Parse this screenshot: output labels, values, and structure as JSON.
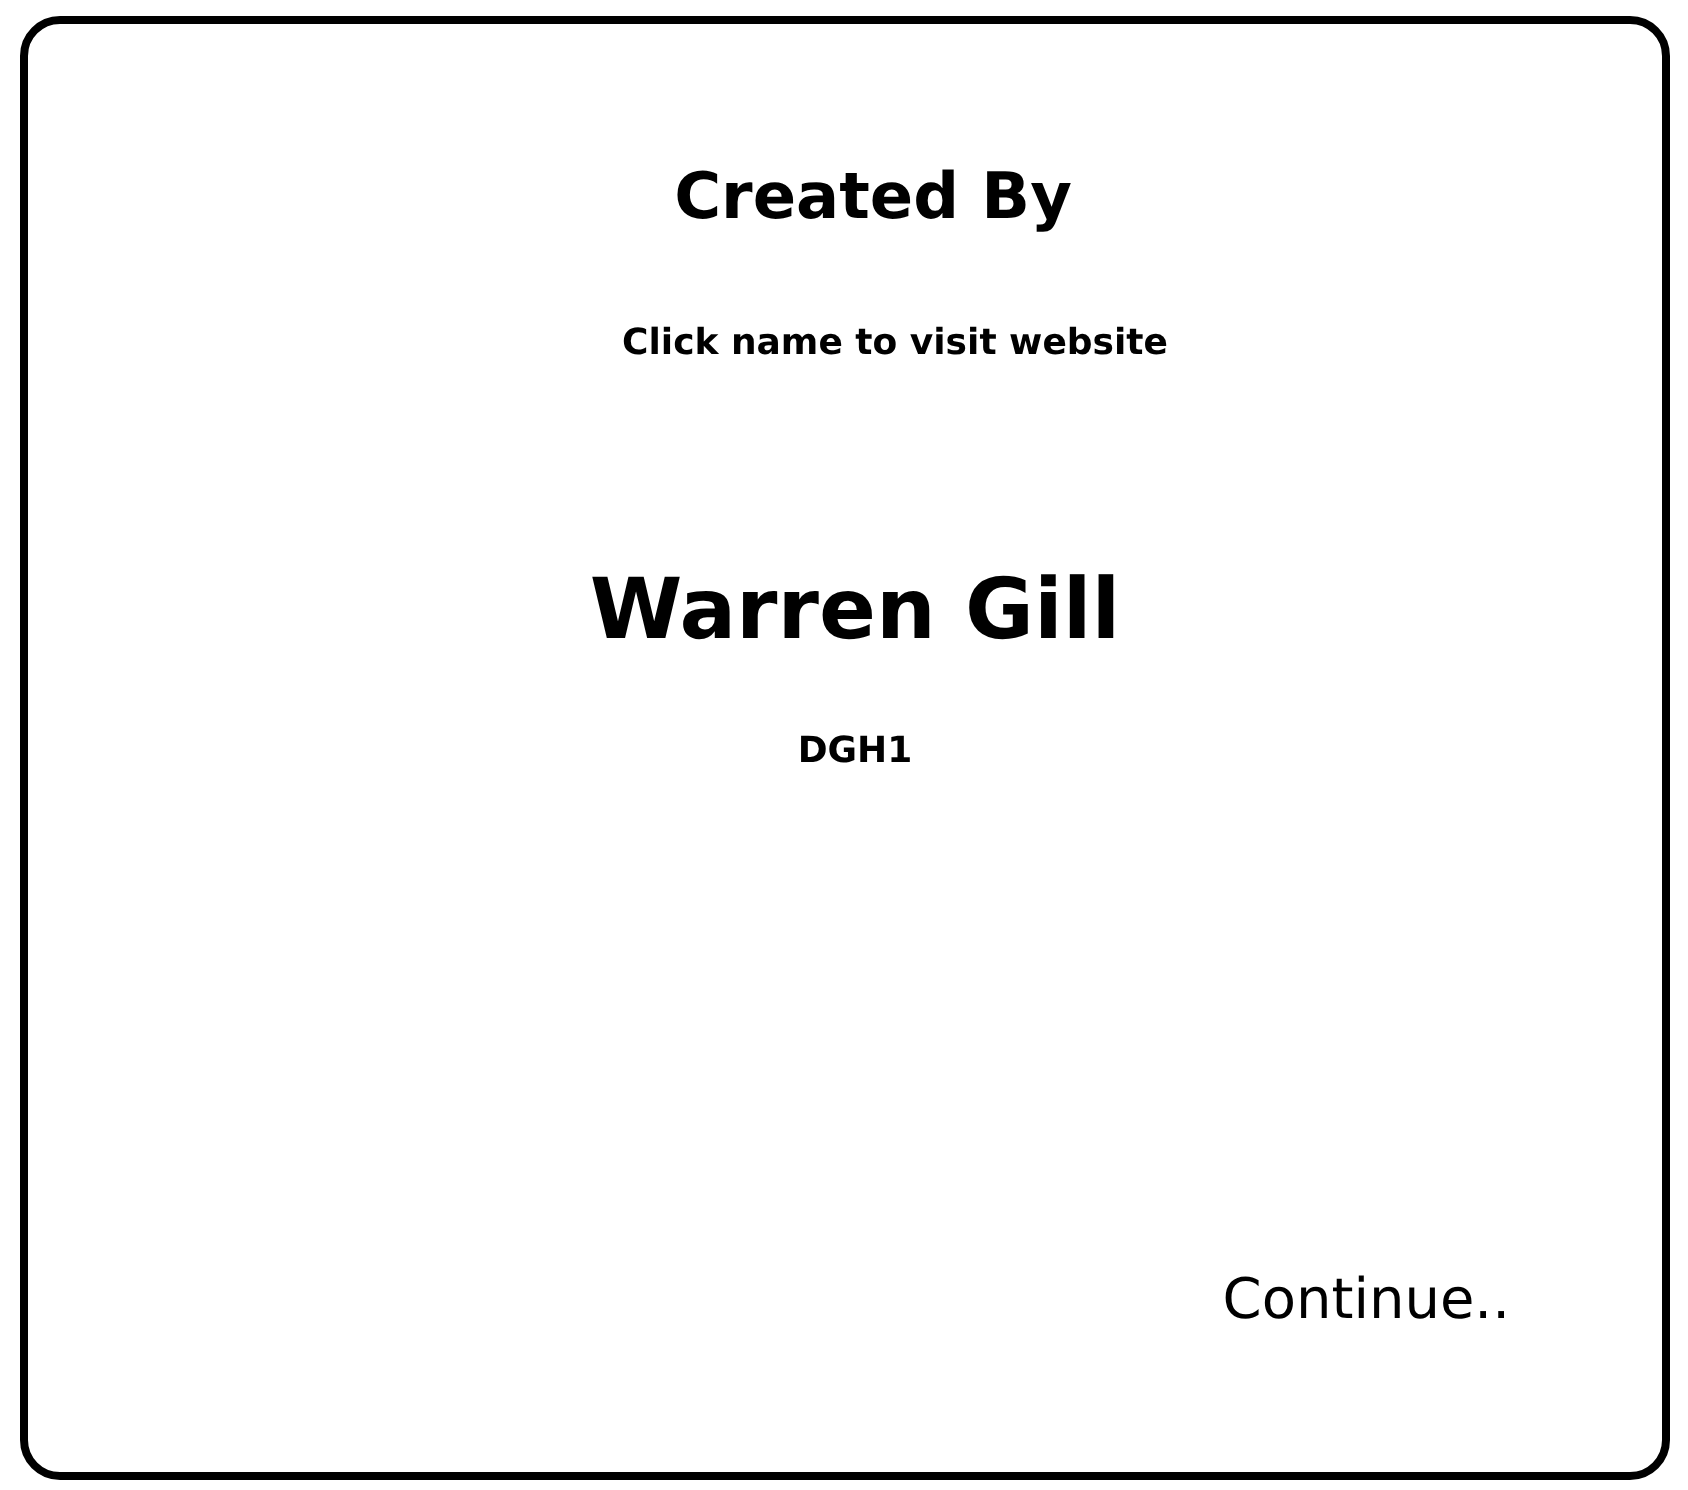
{
  "title": "Created By",
  "hint": "Click name to visit website",
  "author": {
    "name": "Warren Gill",
    "handle": "DGH1"
  },
  "continue_button": "Continue.."
}
